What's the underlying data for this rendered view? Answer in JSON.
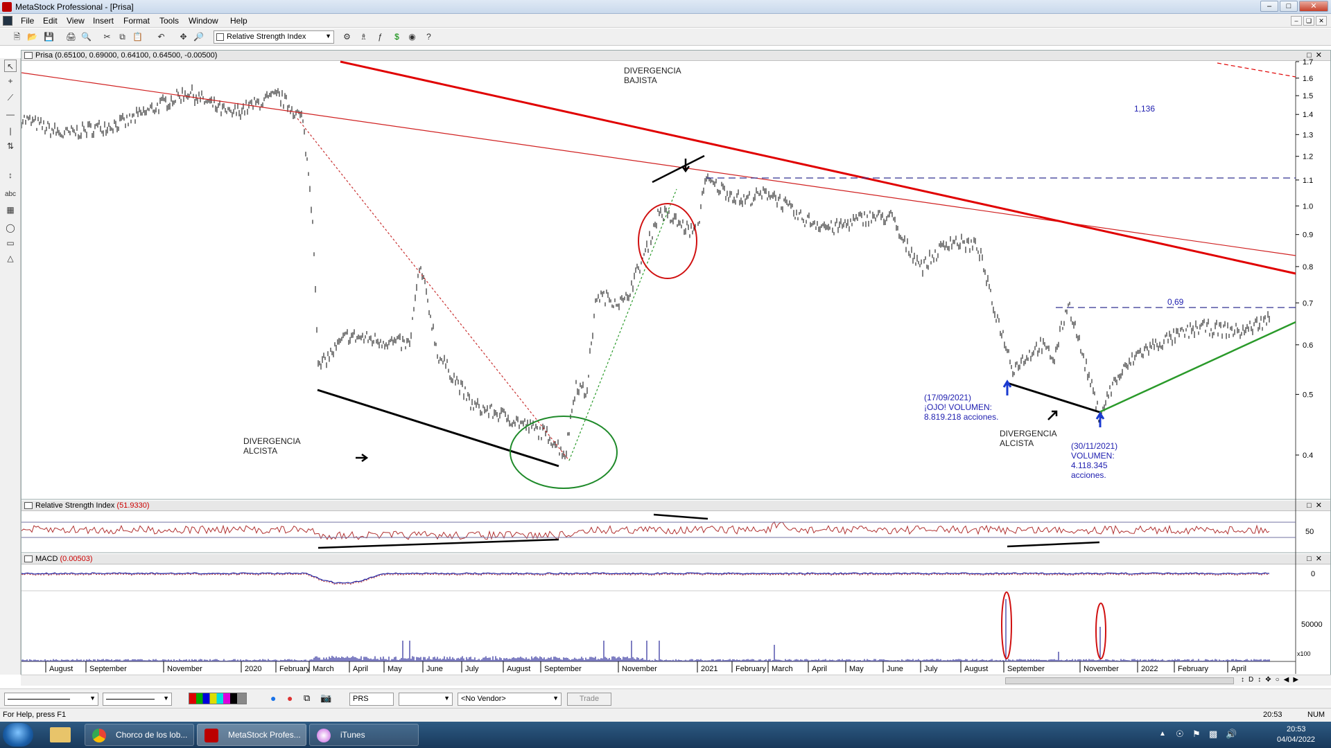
{
  "window": {
    "title": "MetaStock Professional - [Prisa]"
  },
  "menu": [
    "File",
    "Edit",
    "View",
    "Insert",
    "Format",
    "Tools",
    "Window",
    "Help"
  ],
  "toolbar": {
    "indicator_select": "Relative Strength Index"
  },
  "price_panel": {
    "title": "Prisa",
    "values": "(0.65100, 0.69000, 0.64100, 0.64500, -0.00500)",
    "yticks": [
      "1.7",
      "1.6",
      "1.5",
      "1.4",
      "1.3",
      "1.2",
      "1.1",
      "1.0",
      "0.9",
      "0.8",
      "0.7",
      "0.6",
      "0.5",
      "0.4"
    ],
    "annotations": {
      "div_bajista": [
        "DIVERGENCIA",
        "BAJISTA"
      ],
      "div_alcista_1": [
        "DIVERGENCIA",
        "ALCISTA"
      ],
      "div_alcista_2": [
        "DIVERGENCIA",
        "ALCISTA"
      ],
      "level_high": "1,136",
      "level_low": "0,69",
      "vol_note_1": [
        "(17/09/2021)",
        "¡OJO! VOLUMEN:",
        "8.819.218 acciones."
      ],
      "vol_note_2": [
        "(30/11/2021)",
        "VOLUMEN:",
        "4.118.345",
        "acciones."
      ]
    }
  },
  "rsi_panel": {
    "title": "Relative Strength Index",
    "value": "(51.9330)",
    "ytick": "50"
  },
  "macd_panel": {
    "title": "MACD",
    "value": "(0.00503)",
    "ytick": "0"
  },
  "volume_panel": {
    "ytick": "50000",
    "unit": "x100"
  },
  "x_axis": [
    "August",
    "September",
    "November",
    "2020",
    "February",
    "March",
    "April",
    "May",
    "June",
    "July",
    "August",
    "September",
    "November",
    "2021",
    "February",
    "March",
    "April",
    "May",
    "June",
    "July",
    "August",
    "September",
    "November",
    "2022",
    "February",
    "April"
  ],
  "format_bar": {
    "symbol": "PRS",
    "vendor": "<No Vendor>",
    "trade": "Trade"
  },
  "status": {
    "help": "For Help, press F1",
    "time": "20:53",
    "num": "NUM"
  },
  "taskbar": {
    "apps": [
      "Chorco de los lob...",
      "MetaStock Profes...",
      "iTunes"
    ],
    "clock_time": "20:53",
    "clock_date": "04/04/2022"
  },
  "colors": {
    "trend_red": "#e00000",
    "trend_green": "#2a9a2a",
    "price": "#000000",
    "annotation_blue": "#2020b0",
    "rsi_line": "#b03030",
    "macd_line": "#1a1a9a"
  }
}
